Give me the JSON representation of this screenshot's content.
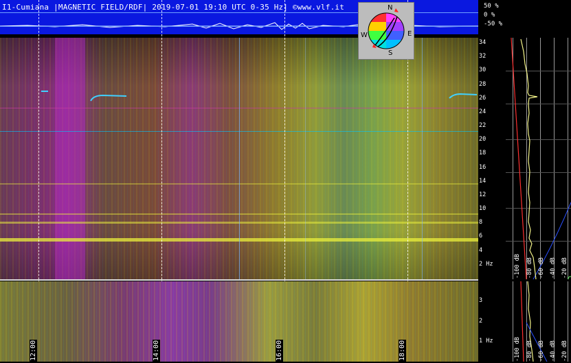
{
  "header": {
    "title": "I1-Cumiana |MAGNETIC FIELD/RDF| 2019-07-01 19:10 UTC 0-35 Hz| ©www.vlf.it"
  },
  "percent_axis": [
    "50 %",
    "0 %",
    "-50 %"
  ],
  "compass": {
    "n": "N",
    "e": "E",
    "s": "S",
    "w": "W"
  },
  "freq_axis_top": [
    "34",
    "32",
    "30",
    "28",
    "26",
    "24",
    "22",
    "20",
    "18",
    "16",
    "14",
    "12",
    "10",
    "8",
    "6",
    "4",
    "2 Hz"
  ],
  "freq_axis_bottom": [
    "3",
    "2",
    "1 Hz"
  ],
  "db_labels_top": [
    "-100 dB",
    "-80 dB",
    "-60 dB",
    "-40 dB",
    "-20 dB"
  ],
  "db_labels_bottom": [
    "-100 dB",
    "-80 dB",
    "-60 dB",
    "-40 dB",
    "-20 dB"
  ],
  "time_labels": [
    "12:00",
    "14:00",
    "16:00",
    "18:00"
  ],
  "colors": {
    "header_bg": "#0a18e0",
    "trace": "#f5f58a",
    "reference": "#ff3030"
  }
}
